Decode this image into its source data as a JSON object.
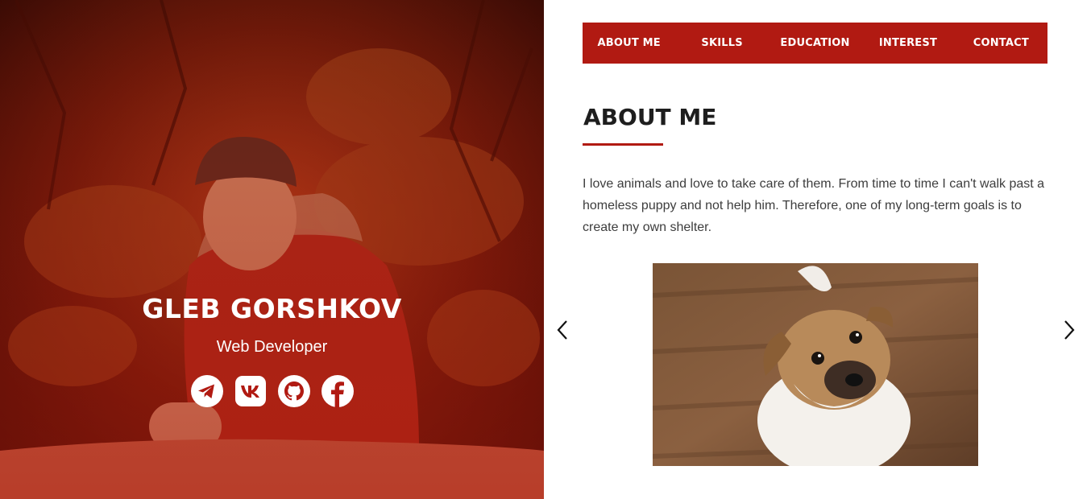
{
  "hero": {
    "name": "GLEB GORSHKOV",
    "role": "Web Developer",
    "socials": [
      {
        "icon": "telegram-icon"
      },
      {
        "icon": "vk-icon"
      },
      {
        "icon": "github-icon"
      },
      {
        "icon": "facebook-icon"
      }
    ]
  },
  "nav": {
    "items": [
      "ABOUT ME",
      "SKILLS",
      "EDUCATION",
      "INTEREST",
      "CONTACT"
    ]
  },
  "about": {
    "title": "ABOUT ME",
    "text": "I love animals and love to take care of them. From time to time I can't walk past a homeless puppy and not help him. Therefore, one of my long-term goals is to create my own shelter."
  },
  "carousel": {
    "prev_icon": "chevron-left-icon",
    "next_icon": "chevron-right-icon"
  },
  "colors": {
    "accent": "#b11a12",
    "heading": "#1e1e1e",
    "body_text": "#3d3d3d"
  }
}
